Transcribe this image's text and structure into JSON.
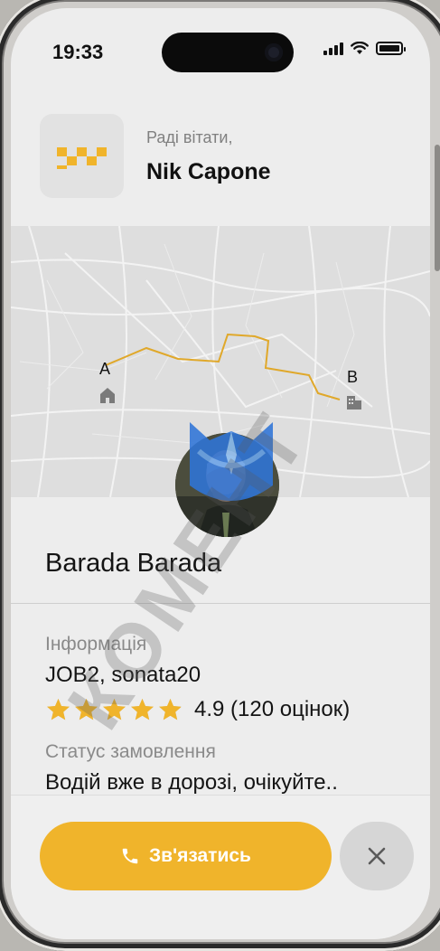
{
  "status_bar": {
    "time": "19:33"
  },
  "header": {
    "greeting": "Раді вітати,",
    "user_name": "Nik Capone"
  },
  "map": {
    "start_label": "A",
    "end_label": "B",
    "route_color": "#e0a82a"
  },
  "driver": {
    "name": "Barada Barada",
    "info_label": "Інформація",
    "info_value": "JOB2, sonata20",
    "rating": 4.9,
    "rating_text": "4.9 (120 оцінок)",
    "status_label": "Статус замовлення",
    "status_value": "Водій вже в дорозі, очікуйте.."
  },
  "actions": {
    "contact_label": "Зв'язатись"
  },
  "watermark": {
    "text": "КОМЕНТ"
  },
  "colors": {
    "accent": "#f0b42b",
    "star": "#f0b42b",
    "text": "#141414",
    "muted": "#8a8a8a"
  }
}
